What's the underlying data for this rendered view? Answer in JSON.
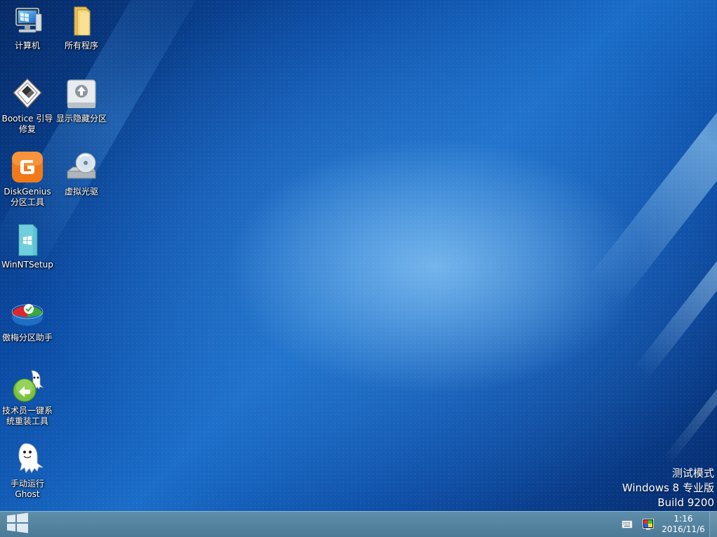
{
  "desktop": {
    "icons": [
      {
        "label": "计算机"
      },
      {
        "label": "所有程序"
      },
      {
        "label": "Bootice 引导修复"
      },
      {
        "label": "显示隐藏分区"
      },
      {
        "label": "DiskGenius分区工具"
      },
      {
        "label": "虚拟光驱"
      },
      {
        "label": "WinNTSetup"
      },
      {
        "label": "傲梅分区助手"
      },
      {
        "label": "技术员一键系统重装工具"
      },
      {
        "label": "手动运行Ghost"
      }
    ]
  },
  "watermark": {
    "line1": "测试模式",
    "line2": "Windows 8 专业版",
    "line3": "Build 9200"
  },
  "taskbar": {
    "clock_time": "1:16",
    "clock_date": "2016/11/6",
    "tray_icons": [
      "keyboard-icon",
      "display-color-icon"
    ]
  },
  "colors": {
    "taskbar": "#5585a2",
    "desktop_blue": "#0b4ba4"
  }
}
